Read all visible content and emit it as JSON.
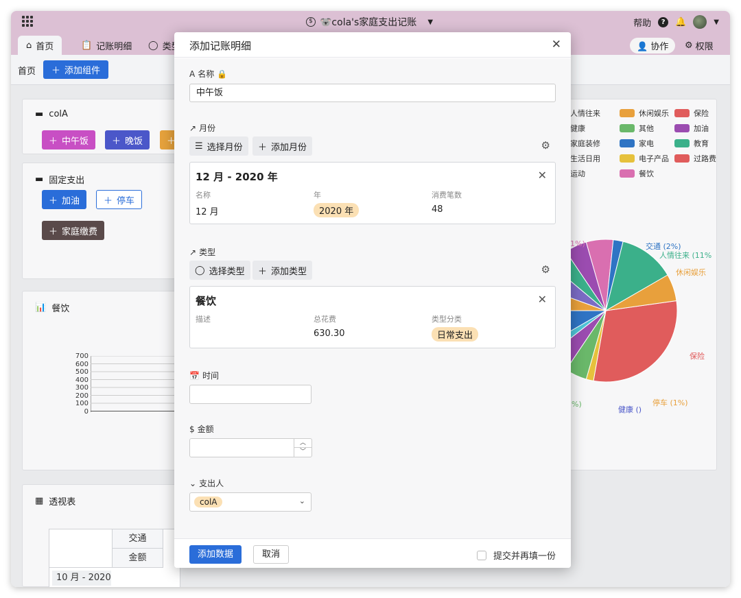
{
  "app": {
    "title": "🐨cola's家庭支出记账",
    "help_label": "帮助"
  },
  "tabs": [
    {
      "label": "首页"
    },
    {
      "label": "记账明细"
    },
    {
      "label": "类型"
    }
  ],
  "tab_actions": {
    "collab_label": "协作",
    "perm_label": "权限"
  },
  "toolbar": {
    "breadcrumb": "首页",
    "add_component_label": "添加组件"
  },
  "background": {
    "card_cola": {
      "title": "colA",
      "buttons": [
        "中午饭",
        "晚饭"
      ]
    },
    "card_fixed": {
      "title": "固定支出",
      "buttons": [
        "加油",
        "停车",
        "家庭缴费"
      ]
    },
    "card_dining": {
      "title": "餐饮",
      "y_ticks": [
        "700",
        "600",
        "500",
        "400",
        "300",
        "200",
        "100",
        "0"
      ]
    },
    "card_pivot": {
      "title": "透视表",
      "col_header": "交通",
      "row_header": "金额",
      "row_label": "10 月 - 2020"
    },
    "legend": [
      {
        "label": "人情往来",
        "color": "#4b9fc9"
      },
      {
        "label": "休闲娱乐",
        "color": "#e8a03c"
      },
      {
        "label": "保险",
        "color": "#e05c5c"
      },
      {
        "label": "健康",
        "color": "#7b6cc4"
      },
      {
        "label": "其他",
        "color": "#6ab86a"
      },
      {
        "label": "加油",
        "color": "#9b4cb0"
      },
      {
        "label": "家庭装修",
        "color": "#4ec3d6"
      },
      {
        "label": "家电",
        "color": "#2f74c4"
      },
      {
        "label": "教育",
        "color": "#3bb08a"
      },
      {
        "label": "生活日用",
        "color": "#e05c5c"
      },
      {
        "label": "电子产品",
        "color": "#e6c13c"
      },
      {
        "label": "过路费",
        "color": "#e05c5c"
      },
      {
        "label": "运动",
        "color": "#9b4cb0"
      },
      {
        "label": "餐饮",
        "color": "#d96fb0"
      }
    ],
    "pie_labels": {
      "jiaotong": "交通 (2%)",
      "renqing": "人情往来 (11%",
      "xiuxian": "休闲娱乐",
      "baoxian": "保险",
      "tingche": "停车 (1%)",
      "jiankang": "健康 ()",
      "left_top": "1%)",
      "left_bottom": "%)"
    }
  },
  "modal": {
    "title": "添加记账明细",
    "name": {
      "label": "名称",
      "value": "中午饭"
    },
    "month": {
      "label": "月份",
      "select_label": "选择月份",
      "add_label": "添加月份",
      "record": {
        "title": "12 月 - 2020 年",
        "cols": [
          {
            "header": "名称",
            "value": "12 月"
          },
          {
            "header": "年",
            "value": "2020 年"
          },
          {
            "header": "消费笔数",
            "value": "48"
          }
        ]
      }
    },
    "type": {
      "label": "类型",
      "select_label": "选择类型",
      "add_label": "添加类型",
      "record": {
        "title": "餐饮",
        "cols": [
          {
            "header": "描述",
            "value": ""
          },
          {
            "header": "总花费",
            "value": "630.30"
          },
          {
            "header": "类型分类",
            "value": "日常支出"
          }
        ]
      }
    },
    "time": {
      "label": "时间",
      "value": ""
    },
    "amount": {
      "label": "金额",
      "value": ""
    },
    "payer": {
      "label": "支出人",
      "value": "colA"
    },
    "footer": {
      "submit_label": "添加数据",
      "cancel_label": "取消",
      "again_label": "提交并再填一份"
    }
  }
}
